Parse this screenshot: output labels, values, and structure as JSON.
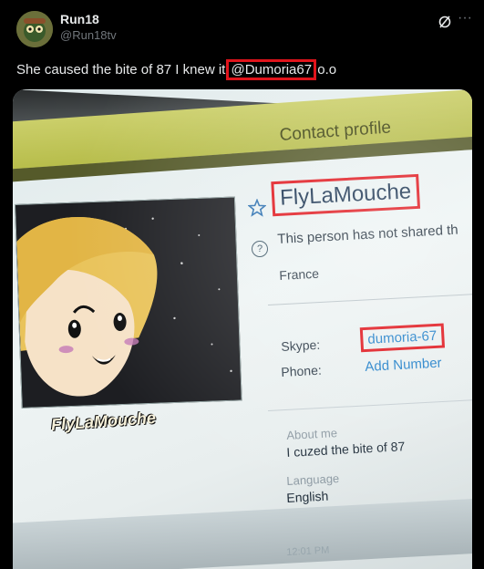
{
  "post": {
    "author_name": "Run18",
    "author_handle": "@Run18tv",
    "text_before": "She caused the bite of 87 I knew it ",
    "mention": "@Dumoria67",
    "text_after": " o.o"
  },
  "photo": {
    "title": "Contact profile",
    "profile_name": "FlyLaMouche",
    "not_shared_text": "This person has not shared th",
    "country": "France",
    "skype_label": "Skype:",
    "skype_value": "dumoria-67",
    "phone_label": "Phone:",
    "phone_value": "Add Number",
    "about_label": "About me",
    "about_value": "I cuzed the bite of 87",
    "language_label": "Language",
    "language_value": "English",
    "avatar_caption": "FlyLaMouche",
    "time_text": "12:01 PM"
  },
  "icons": {
    "grok": "grok-icon",
    "more": "more-icon",
    "star": "star-icon",
    "help": "help-icon"
  },
  "colors": {
    "highlight_box": "#e0141b",
    "title_bar": "#b7bd4b",
    "link_blue": "#1f7fc9"
  }
}
